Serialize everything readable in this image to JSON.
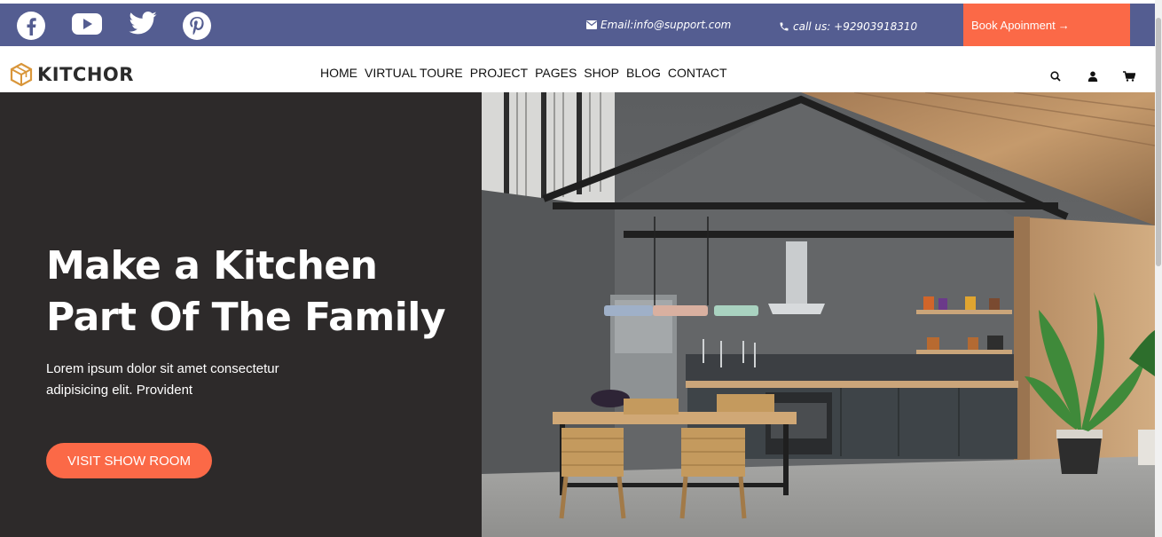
{
  "topbar": {
    "email": "Email:info@support.com",
    "phone": "call us: +92903918310",
    "book_label": "Book Apoinment",
    "book_arrow": "→",
    "social": [
      "facebook-icon",
      "youtube-icon",
      "twitter-icon",
      "pinterest-icon"
    ]
  },
  "nav": {
    "logo_text": "KITCHOR",
    "menu": [
      "HOME",
      "VIRTUAL TOURE",
      "PROJECT",
      "PAGES",
      "SHOP",
      "BLOG",
      "CONTACT"
    ],
    "icons": [
      "search-icon",
      "user-icon",
      "cart-icon"
    ]
  },
  "hero": {
    "title": "Make a Kitchen Part Of The Family",
    "subtitle": "Lorem ipsum dolor sit amet consectetur adipisicing elit. Provident",
    "cta_label": "VISIT SHOW ROOM"
  },
  "colors": {
    "topbar_bg": "#545d91",
    "accent": "#fb6947",
    "hero_bg": "#2d2a2a",
    "logo_accent": "#d9963a"
  }
}
